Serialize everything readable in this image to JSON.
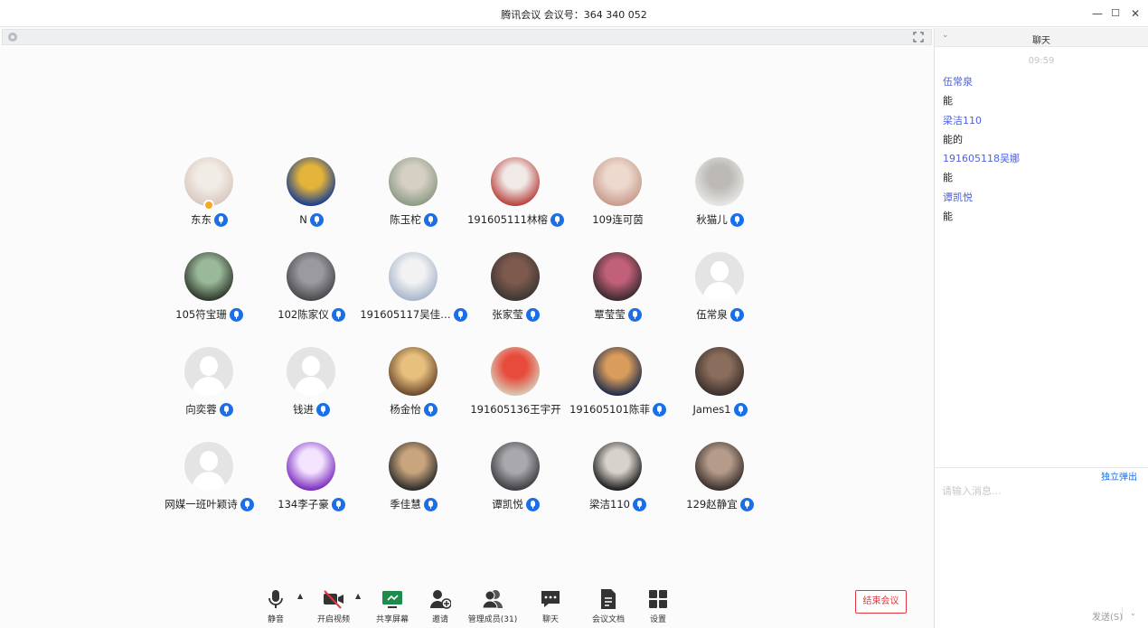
{
  "window": {
    "title": "腾讯会议 会议号：364 340 052",
    "minimize": "—",
    "maximize": "☐",
    "close": "✕"
  },
  "participants": [
    {
      "name": "东东",
      "host": true,
      "colors": [
        "#d9c9bf",
        "#f2ece6"
      ]
    },
    {
      "name": "N",
      "colors": [
        "#1b3f8f",
        "#e4b33a"
      ]
    },
    {
      "name": "陈玉柁",
      "colors": [
        "#8d9b86",
        "#d6d0c4"
      ]
    },
    {
      "name": "191605111林榕",
      "colors": [
        "#b8433f",
        "#f0e9e6"
      ]
    },
    {
      "name": "109连可茵",
      "nomic": true,
      "colors": [
        "#c79d8d",
        "#eed9cf"
      ]
    },
    {
      "name": "秋猫儿",
      "colors": [
        "#e7e6e4",
        "#bdbab6"
      ]
    },
    {
      "name": "105符宝珊",
      "colors": [
        "#2f3a2c",
        "#9ab89a"
      ]
    },
    {
      "name": "102陈家仪",
      "colors": [
        "#4a4a4e",
        "#9a9aa0"
      ]
    },
    {
      "name": "191605117吴佳…",
      "colors": [
        "#a9b7cc",
        "#f2f2f2"
      ]
    },
    {
      "name": "张家莹",
      "colors": [
        "#3c3733",
        "#7e5a4e"
      ]
    },
    {
      "name": "覃莹莹",
      "colors": [
        "#3a2a2e",
        "#c2607a"
      ]
    },
    {
      "name": "伍常泉",
      "gray": true
    },
    {
      "name": "向奕蓉",
      "gray": true
    },
    {
      "name": "钱进",
      "gray": true
    },
    {
      "name": "杨金怡",
      "colors": [
        "#6b4a2f",
        "#e8c07d"
      ]
    },
    {
      "name": "191605136王宇开",
      "nomic": true,
      "colors": [
        "#d9c8b4",
        "#e74b3c"
      ]
    },
    {
      "name": "191605101陈菲",
      "colors": [
        "#1f2d4d",
        "#d99c5a"
      ]
    },
    {
      "name": "James1",
      "colors": [
        "#3b2f2c",
        "#8a6d5c"
      ]
    },
    {
      "name": "网媒一班叶颖诗",
      "gray": true
    },
    {
      "name": "134李子豪",
      "colors": [
        "#7b2fbe",
        "#f4e3ff"
      ]
    },
    {
      "name": "季佳慧",
      "colors": [
        "#2b2b2b",
        "#c9a57d"
      ]
    },
    {
      "name": "谭凯悦",
      "colors": [
        "#3e3e42",
        "#a9a9ad"
      ]
    },
    {
      "name": "梁洁110",
      "colors": [
        "#1e1e1e",
        "#d8d2cc"
      ]
    },
    {
      "name": "129赵静宜",
      "colors": [
        "#3a2f2b",
        "#b59b8a"
      ]
    }
  ],
  "toolbar": {
    "items": [
      {
        "id": "mute",
        "label": "静音",
        "icon": "microphone-icon",
        "caret": true
      },
      {
        "id": "video",
        "label": "开启视频",
        "icon": "video-off-icon",
        "caret": true
      },
      {
        "id": "share",
        "label": "共享屏幕",
        "icon": "share-screen-icon"
      },
      {
        "id": "invite",
        "label": "邀请",
        "icon": "add-user-icon"
      },
      {
        "id": "members",
        "label": "管理成员(31)",
        "icon": "members-icon"
      },
      {
        "id": "chat",
        "label": "聊天",
        "icon": "chat-icon"
      },
      {
        "id": "docs",
        "label": "会议文档",
        "icon": "document-icon"
      },
      {
        "id": "settings",
        "label": "设置",
        "icon": "settings-grid-icon"
      }
    ],
    "end_label": "结束会议",
    "accent_color": "#1a6fe8",
    "end_color": "#e0383e"
  },
  "chat": {
    "title": "聊天",
    "time": "09:59",
    "messages": [
      {
        "sender": "伍常泉",
        "text": "能"
      },
      {
        "sender": "梁洁110",
        "text": "能的"
      },
      {
        "sender": "191605118吴娜",
        "text": "能"
      },
      {
        "sender": "谭凯悦",
        "text": "能"
      }
    ],
    "popout_label": "独立弹出",
    "input_placeholder": "请输入消息...",
    "send_label": "发送(S)"
  }
}
